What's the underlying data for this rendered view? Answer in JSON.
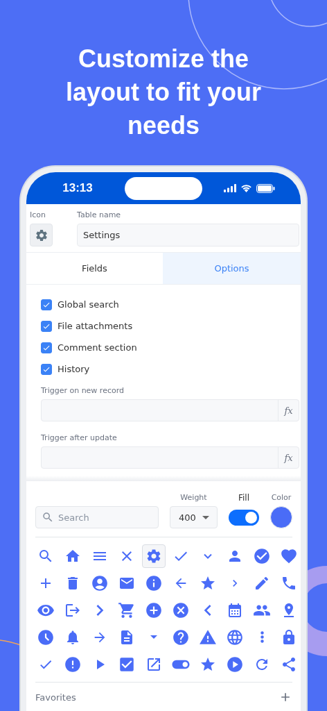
{
  "headline": "Customize the layout to fit your needs",
  "status_bar": {
    "time": "13:13"
  },
  "table": {
    "icon_label": "Icon",
    "name_label": "Table name",
    "name_value": "Settings"
  },
  "tabs": [
    {
      "label": "Fields",
      "selected": false
    },
    {
      "label": "Options",
      "selected": true
    }
  ],
  "options": [
    {
      "label": "Global search",
      "checked": true
    },
    {
      "label": "File attachments",
      "checked": true
    },
    {
      "label": "Comment section",
      "checked": true
    },
    {
      "label": "History",
      "checked": true
    }
  ],
  "triggers": [
    {
      "label": "Trigger on new record",
      "button": "fx"
    },
    {
      "label": "Trigger after update",
      "button": "fx"
    }
  ],
  "icon_picker": {
    "search_placeholder": "Search",
    "weight_label": "Weight",
    "weight_value": "400",
    "fill_label": "Fill",
    "fill_on": true,
    "color_label": "Color",
    "color": "#4a6cf7",
    "icons": [
      {
        "selected": false
      },
      {
        "selected": false
      },
      {
        "selected": false
      },
      {
        "selected": false
      },
      {
        "selected": true
      },
      {
        "selected": false
      },
      {
        "selected": false
      },
      {
        "selected": false
      },
      {
        "selected": false
      },
      {
        "selected": false
      },
      {
        "selected": false
      },
      {
        "selected": false
      },
      {
        "selected": false
      },
      {
        "selected": false
      },
      {
        "selected": false
      },
      {
        "selected": false
      },
      {
        "selected": false
      },
      {
        "selected": false
      },
      {
        "selected": false
      },
      {
        "selected": false
      },
      {
        "selected": false
      },
      {
        "selected": false
      },
      {
        "selected": false
      },
      {
        "selected": false
      },
      {
        "selected": false
      },
      {
        "selected": false
      },
      {
        "selected": false
      },
      {
        "selected": false
      },
      {
        "selected": false
      },
      {
        "selected": false
      },
      {
        "selected": false
      },
      {
        "selected": false
      },
      {
        "selected": false
      },
      {
        "selected": false
      },
      {
        "selected": false
      },
      {
        "selected": false
      },
      {
        "selected": false
      },
      {
        "selected": false
      },
      {
        "selected": false
      },
      {
        "selected": false
      },
      {
        "selected": false
      },
      {
        "selected": false
      },
      {
        "selected": false
      },
      {
        "selected": false
      },
      {
        "selected": false
      },
      {
        "selected": false
      },
      {
        "selected": false
      },
      {
        "selected": false
      },
      {
        "selected": false
      },
      {
        "selected": false
      }
    ],
    "favorites_label": "Favorites"
  }
}
